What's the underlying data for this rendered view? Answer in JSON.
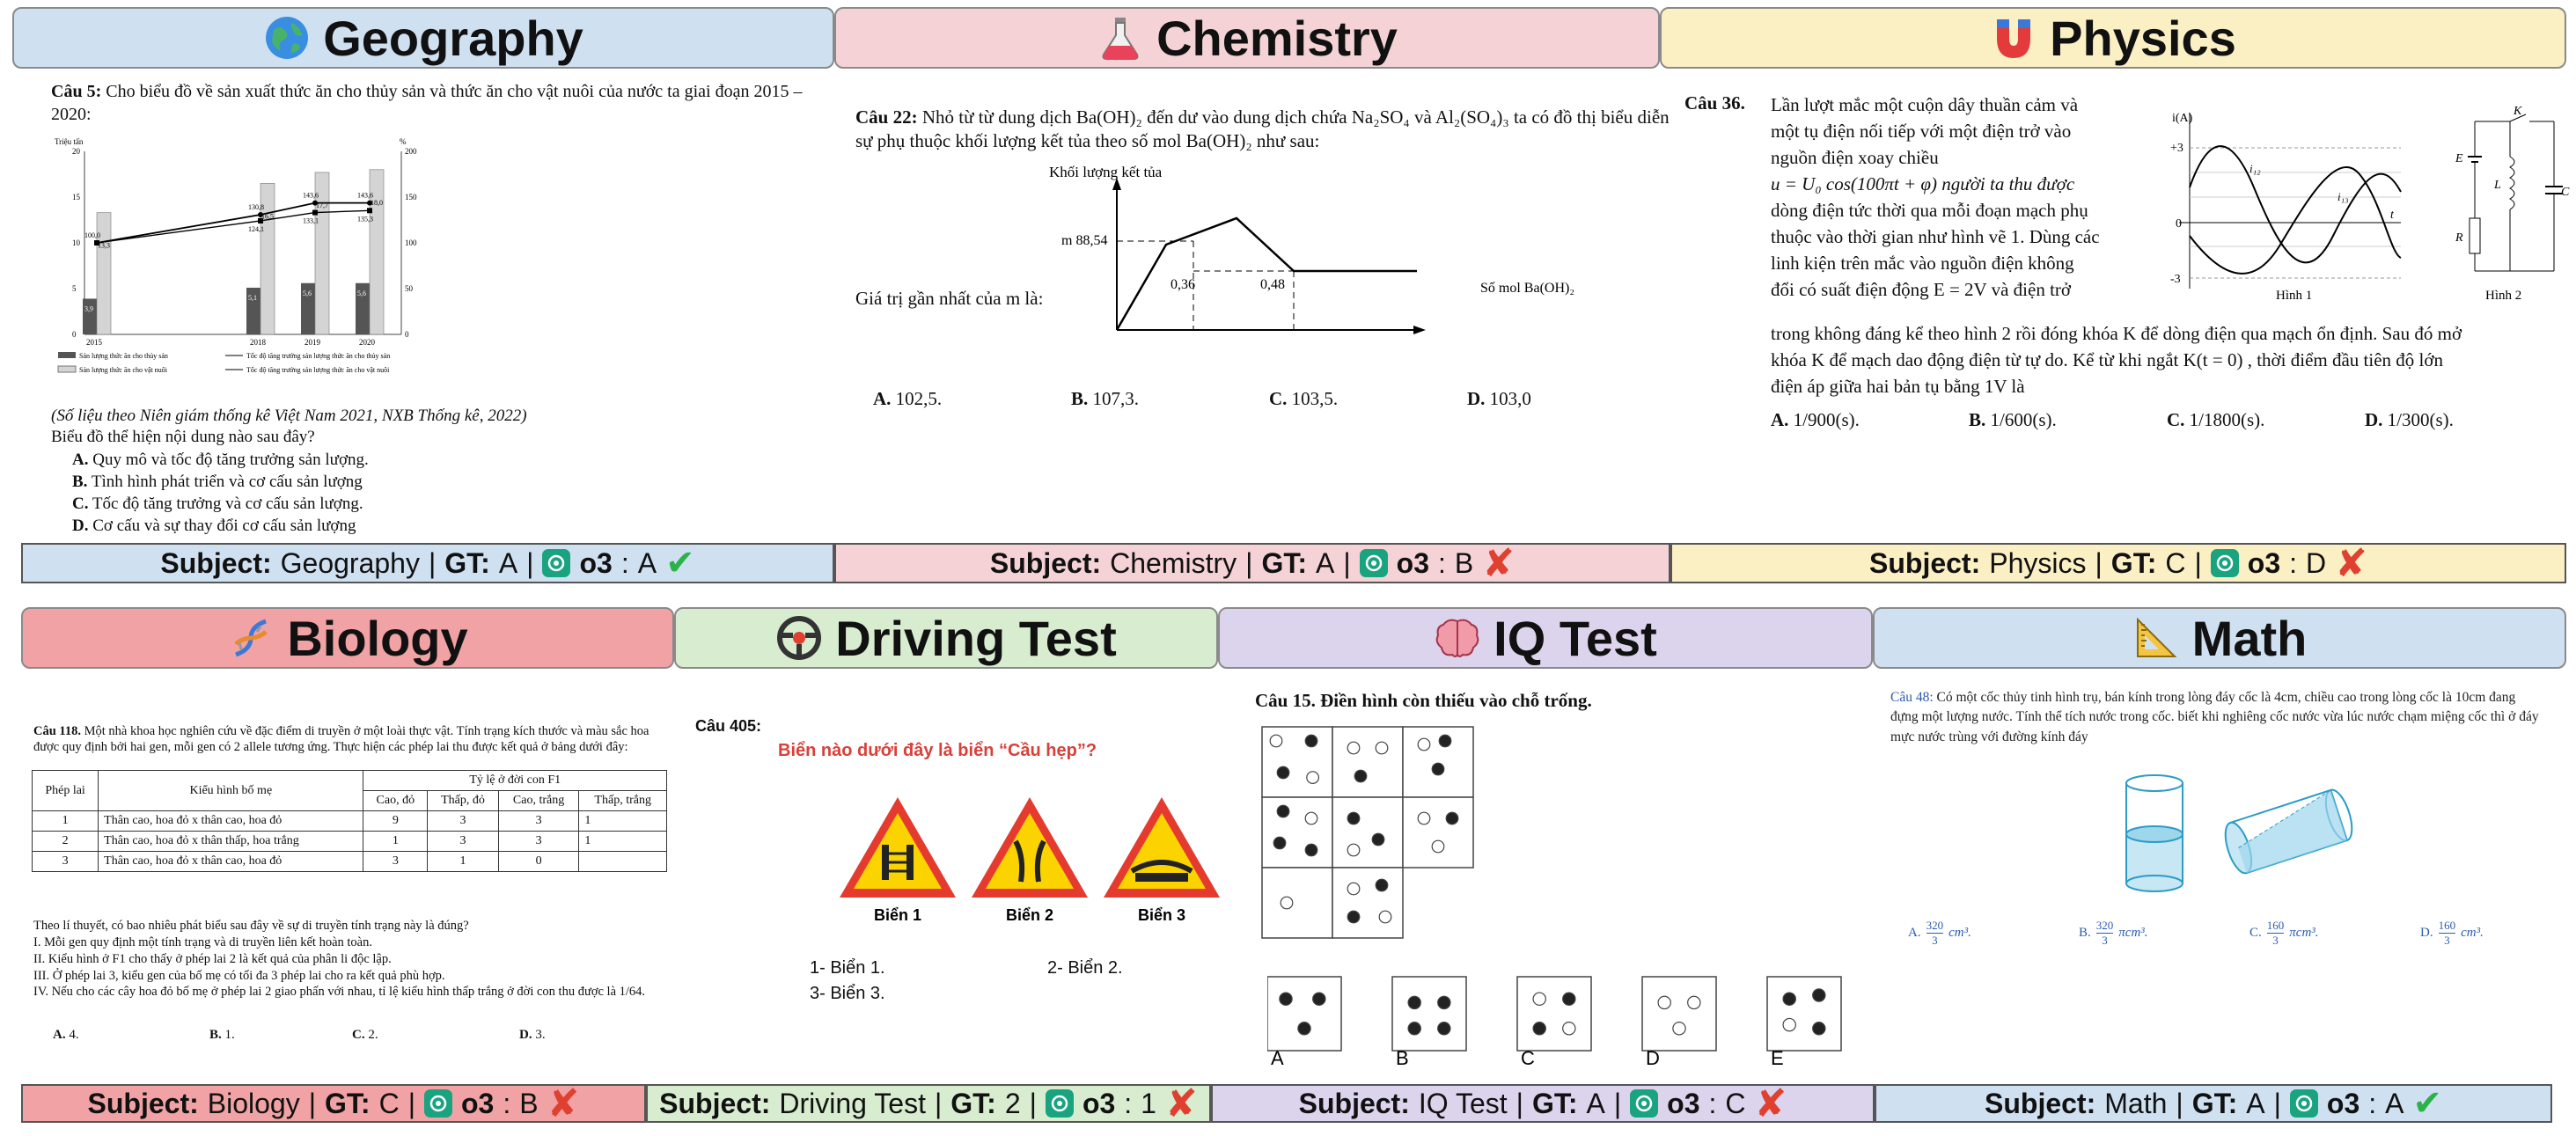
{
  "panels": {
    "geography": {
      "title": "Geography",
      "icon": "globe-icon",
      "bar": {
        "subject_label": "Subject:",
        "subject": "Geography",
        "sep": "|",
        "gt_label": "GT:",
        "gt": "A",
        "model": "o3",
        "answer": "A",
        "result": "correct"
      },
      "question": {
        "label": "Câu 5:",
        "stem": "Cho biểu đồ về sản xuất thức ăn cho thủy sản và thức ăn cho vật nuôi của nước ta giai đoạn 2015 – 2020:",
        "source": "(Số liệu theo Niên giám thống kê Việt Nam 2021, NXB Thống kê, 2022)",
        "prompt": "Biểu đồ thể hiện nội dung nào sau đây?",
        "options": [
          {
            "letter": "A.",
            "text": "Quy mô và tốc độ tăng trưởng sản lượng."
          },
          {
            "letter": "B.",
            "text": "Tình hình phát triển và cơ cấu sản lượng"
          },
          {
            "letter": "C.",
            "text": "Tốc độ tăng trưởng và cơ cấu sản lượng."
          },
          {
            "letter": "D.",
            "text": "Cơ cấu và sự thay đổi cơ cấu sản lượng"
          }
        ]
      },
      "chart_data": {
        "type": "bar",
        "categories": [
          "2015",
          "2018",
          "2019",
          "2020"
        ],
        "left_axis_label": "Triệu tấn",
        "right_axis_label": "%",
        "left_ticks": [
          "0",
          "5",
          "10",
          "15",
          "20"
        ],
        "right_ticks": [
          "0",
          "50",
          "100",
          "150",
          "200"
        ],
        "series": [
          {
            "values": [
              3.9,
              5.1,
              5.6,
              5.6
            ],
            "labels": [
              "3,9",
              "5,1",
              "5,6",
              "5,6"
            ]
          },
          {
            "values": [
              13.3,
              16.5,
              17.7,
              18.0
            ],
            "labels": [
              "13,3",
              "16,5",
              "17,7",
              "18,0"
            ]
          }
        ],
        "line_series": [
          {
            "values": [
              100.0,
              130.8,
              143.6,
              143.6
            ],
            "labels": [
              "100,0",
              "130,8",
              "143,6",
              "143,6"
            ]
          },
          {
            "values": [
              100.0,
              124.1,
              133.1,
              135.3
            ],
            "labels": [
              "",
              "124,1",
              "133,1",
              "135,3"
            ]
          }
        ],
        "legend": [
          "Sản lượng thức ăn cho thủy sản",
          "Tốc độ tăng trưởng sản lượng thức ăn cho thủy sản",
          "Sản lượng thức ăn cho vật nuôi",
          "Tốc độ tăng trưởng sản lượng thức ăn cho vật nuôi"
        ]
      }
    },
    "chemistry": {
      "title": "Chemistry",
      "icon": "flask-icon",
      "bar": {
        "subject_label": "Subject:",
        "subject": "Chemistry",
        "sep": "|",
        "gt_label": "GT:",
        "gt": "A",
        "model": "o3",
        "answer": "B",
        "result": "wrong"
      },
      "question": {
        "label": "Câu 22:",
        "stem": "Nhỏ từ từ dung dịch Ba(OH)₂ đến dư vào dung dịch chứa Na₂SO₄ và Al₂(SO₄)₃ ta có đồ thị biểu diễn sự phụ thuộc khối lượng kết tủa theo số mol Ba(OH)₂ như sau:",
        "ask": "Giá trị gần nhất của m là:",
        "options": [
          {
            "letter": "A.",
            "text": "102,5."
          },
          {
            "letter": "B.",
            "text": "107,3."
          },
          {
            "letter": "C.",
            "text": "103,5."
          },
          {
            "letter": "D.",
            "text": "103,0"
          }
        ]
      },
      "chart_data": {
        "type": "line",
        "ylabel": "Khối lượng kết tủa",
        "xlabel": "Số mol Ba(OH)₂",
        "m_label": "m 88,54",
        "x_ticks": [
          "0,36",
          "0,48"
        ]
      }
    },
    "physics": {
      "title": "Physics",
      "icon": "magnet-icon",
      "bar": {
        "subject_label": "Subject:",
        "subject": "Physics",
        "sep": "|",
        "gt_label": "GT:",
        "gt": "C",
        "model": "o3",
        "answer": "D",
        "result": "wrong"
      },
      "question": {
        "label": "Câu 36.",
        "text_lines": [
          "Lần lượt mắc một cuộn dây thuần cảm và",
          "một tụ điện nối tiếp với một điện trở vào",
          "nguồn         điện         xoay         chiều",
          "u = U₀ cos(100πt + φ)    người ta thu được",
          "dòng điện tức thời qua mỗi đoạn mạch phụ",
          "thuộc vào thời gian như hình vẽ 1. Dùng các",
          "linh kiện trên mắc vào nguồn điện không",
          "đổi có suất điện động  E = 2V  và điện trở"
        ],
        "text_full": [
          "trong không đáng kể theo hình 2 rồi đóng khóa  K  để dòng điện qua mạch ổn định. Sau đó mở",
          "khóa K để mạch dao động điện từ tự do. Kể từ khi ngắt  K(t = 0) , thời điểm đầu tiên độ lớn",
          "điện áp giữa hai bản tụ bằng 1V là"
        ],
        "options": [
          {
            "letter": "A.",
            "text": "1/900(s)."
          },
          {
            "letter": "B.",
            "text": "1/600(s)."
          },
          {
            "letter": "C.",
            "text": "1/1800(s)."
          },
          {
            "letter": "D.",
            "text": "1/300(s)."
          }
        ],
        "fig1_caption": "Hình 1",
        "fig2_caption": "Hình 2",
        "fig1_labels": {
          "y": "i(A)",
          "p3": "+3",
          "zero": "0",
          "m3": "-3",
          "t": "t",
          "i1": "i₁₂",
          "i2": "i₁₃"
        },
        "fig2_labels": {
          "k": "K",
          "e": "E",
          "l": "L",
          "r": "R",
          "c": "C"
        }
      }
    },
    "biology": {
      "title": "Biology",
      "icon": "dna-icon",
      "bar": {
        "subject_label": "Subject:",
        "subject": "Biology",
        "sep": "|",
        "gt_label": "GT:",
        "gt": "C",
        "model": "o3",
        "answer": "B",
        "result": "wrong"
      },
      "question": {
        "label": "Câu 118.",
        "stem": "Một nhà khoa học nghiên cứu về đặc điểm di truyền ở một loài thực vật. Tính trạng kích thước và màu sắc hoa được quy định bởi hai gen, mỗi gen có 2 allele tương ứng. Thực hiện các phép lai thu được kết quả ở bảng dưới đây:",
        "table": {
          "h_cross": "Phép lai",
          "h_parents": "Kiểu hình bố mẹ",
          "h_ratio": "Tỷ lệ ở đời con F1",
          "h_cols": [
            "Cao, đỏ",
            "Thấp, đỏ",
            "Cao, trắng",
            "Thấp, trắng"
          ],
          "rows": [
            {
              "n": "1",
              "p": "Thân cao, hoa đỏ x thân cao, hoa đỏ",
              "v": [
                "9",
                "3",
                "3",
                "1"
              ]
            },
            {
              "n": "2",
              "p": "Thân cao, hoa đỏ x thân thấp, hoa trắng",
              "v": [
                "1",
                "3",
                "3",
                "1"
              ]
            },
            {
              "n": "3",
              "p": "Thân cao, hoa đỏ x thân cao, hoa đỏ",
              "v": [
                "3",
                "1",
                "0",
                ""
              ]
            }
          ]
        },
        "lines": [
          "Theo lí thuyết, có bao nhiêu phát biểu sau đây về sự di truyền tính trạng này là đúng?",
          "I. Mỗi gen quy định một tính trạng và di truyền liên kết hoàn toàn.",
          "II. Kiểu hình ở F1 cho thấy ở phép lai 2 là kết quả của phân li độc lập.",
          "III. Ở phép lai 3, kiểu gen của bố mẹ có tối đa 3 phép lai cho ra kết quả phù hợp.",
          "IV. Nếu cho các cây hoa đỏ bố mẹ ở phép lai 2 giao phấn với nhau, tỉ lệ kiểu hình thấp trắng ở đời con thu được là 1/64."
        ],
        "options": [
          {
            "letter": "A.",
            "text": "4."
          },
          {
            "letter": "B.",
            "text": "1."
          },
          {
            "letter": "C.",
            "text": "2."
          },
          {
            "letter": "D.",
            "text": "3."
          }
        ]
      }
    },
    "driving": {
      "title": "Driving Test",
      "icon": "steering-wheel-icon",
      "bar": {
        "subject_label": "Subject:",
        "subject": "Driving Test",
        "sep": "|",
        "gt_label": "GT:",
        "gt": "2",
        "model": "o3",
        "answer": "1",
        "result": "wrong"
      },
      "question": {
        "label": "Câu 405:",
        "stem": "Biển nào dưới đây là biển “Cầu hẹp”?",
        "signs": [
          "Biển 1",
          "Biển 2",
          "Biển 3"
        ],
        "options": [
          "1- Biển 1.",
          "2- Biển 2.",
          "3- Biển 3."
        ]
      }
    },
    "iq": {
      "title": "IQ Test",
      "icon": "brain-icon",
      "bar": {
        "subject_label": "Subject:",
        "subject": "IQ Test",
        "sep": "|",
        "gt_label": "GT:",
        "gt": "A",
        "model": "o3",
        "answer": "C",
        "result": "wrong"
      },
      "question": {
        "label": "Câu 15.",
        "stem": "Điền hình còn thiếu vào chỗ trống.",
        "choices": [
          "A",
          "B",
          "C",
          "D",
          "E"
        ]
      }
    },
    "math": {
      "title": "Math",
      "icon": "triangle-ruler-icon",
      "bar": {
        "subject_label": "Subject:",
        "subject": "Math",
        "sep": "|",
        "gt_label": "GT:",
        "gt": "A",
        "model": "o3",
        "answer": "A",
        "result": "correct"
      },
      "question": {
        "label": "Câu 48:",
        "stem": "Có một cốc thủy tinh hình trụ, bán kính trong lòng đáy cốc là 4cm, chiều cao trong lòng cốc là 10cm đang đựng một lượng nước. Tính thể tích nước trong cốc. biết khi nghiêng cốc nước vừa lúc nước chạm miệng cốc thì ở đáy mực nước trùng với đường kính đáy",
        "options": [
          {
            "letter": "A.",
            "num": "320",
            "den": "3",
            "unit": "cm³."
          },
          {
            "letter": "B.",
            "num": "320",
            "den": "3",
            "unit": "πcm³."
          },
          {
            "letter": "C.",
            "num": "160",
            "den": "3",
            "unit": "πcm³."
          },
          {
            "letter": "D.",
            "num": "160",
            "den": "3",
            "unit": "cm³."
          }
        ]
      }
    }
  },
  "colors": {
    "geo": "#cfe0f1",
    "chem": "#f4d2d6",
    "phys": "#fbefc4",
    "bio": "#f0a2a4",
    "drive": "#d8ecd0",
    "iq": "#dcd3ec",
    "math": "#cfe0f1",
    "correct": "#2bb34a",
    "wrong": "#e04030",
    "gpt": "#19a37f"
  }
}
